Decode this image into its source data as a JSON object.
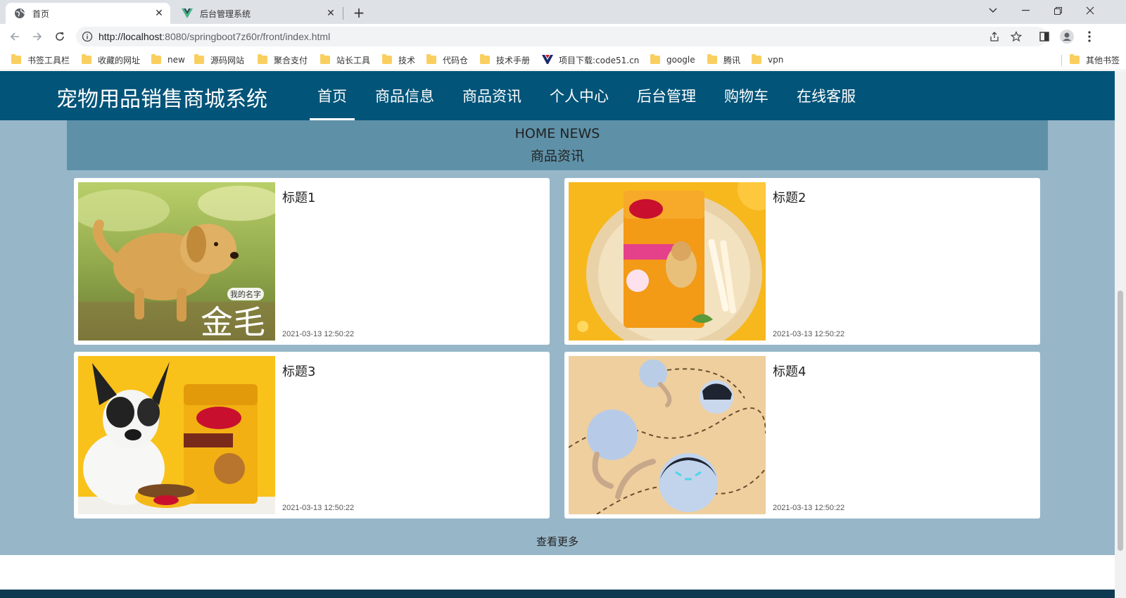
{
  "browser": {
    "tabs": [
      {
        "label": "首页",
        "active": true
      },
      {
        "label": "后台管理系统",
        "active": false
      }
    ],
    "url_host": "http://localhost",
    "url_path": ":8080/springboot7z60r/front/index.html",
    "bookmarks": [
      "书签工具栏",
      "收藏的网址",
      "new",
      "源码网站",
      "聚合支付",
      "站长工具",
      "技术",
      "代码仓",
      "技术手册",
      "项目下载:code51.cn",
      "google",
      "腾讯",
      "vpn"
    ],
    "other_bookmarks": "其他书签"
  },
  "site": {
    "title": "宠物用品销售商城系统",
    "nav": [
      "首页",
      "商品信息",
      "商品资讯",
      "个人中心",
      "后台管理",
      "购物车",
      "在线客服"
    ],
    "active_nav": "首页"
  },
  "news": {
    "heading_en": "HOME NEWS",
    "heading_cn": "商品资讯",
    "items": [
      {
        "title": "标题1",
        "time": "2021-03-13 12:50:22",
        "image": "golden-retriever-puppy",
        "image_text_small": "我的名字",
        "image_text_large": "金毛"
      },
      {
        "title": "标题2",
        "time": "2021-03-13 12:50:22",
        "image": "pedigree-dog-treats"
      },
      {
        "title": "标题3",
        "time": "2021-03-13 12:50:22",
        "image": "french-bulldog-pedigree-food"
      },
      {
        "title": "标题4",
        "time": "2021-03-13 12:50:22",
        "image": "robot-cat-toy-balls"
      }
    ],
    "view_more": "查看更多"
  },
  "colors": {
    "header": "#025479",
    "section_bg": "#97b7c9",
    "heading_bg": "#5e91a8"
  }
}
